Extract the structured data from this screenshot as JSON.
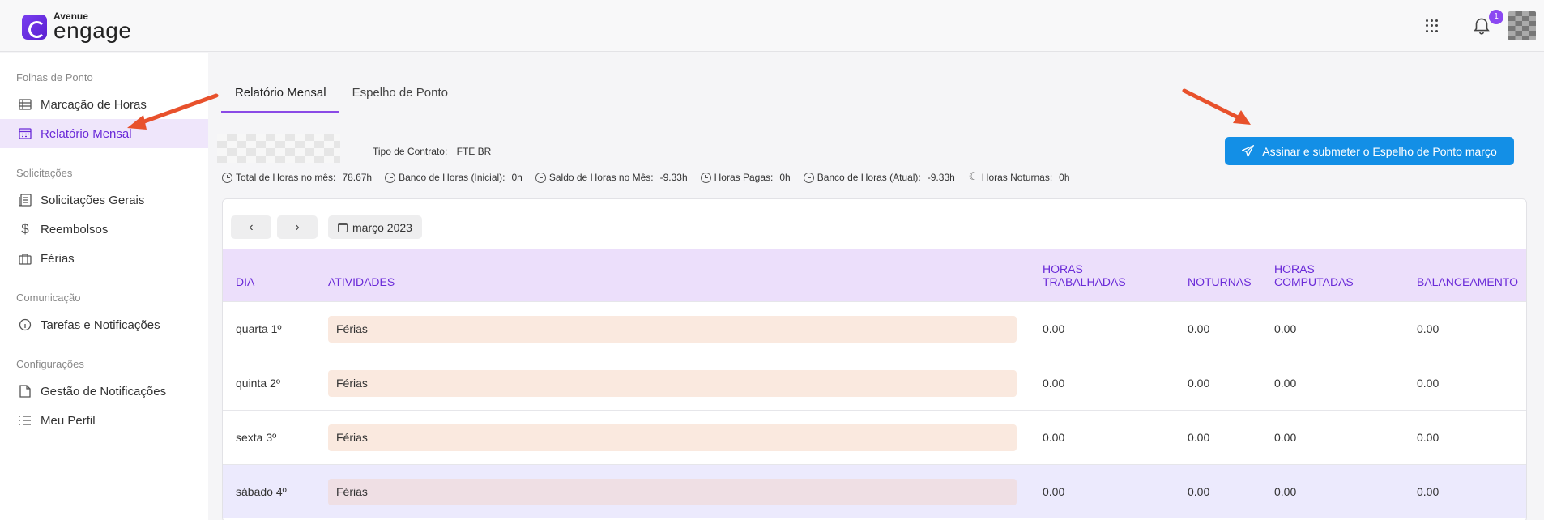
{
  "header": {
    "logo_small": "Avenue",
    "logo_big": "engage",
    "notification_count": "1"
  },
  "sidebar": {
    "sections": [
      {
        "label": "Folhas de Ponto"
      },
      {
        "label": "Solicitações"
      },
      {
        "label": "Comunicação"
      },
      {
        "label": "Configurações"
      }
    ],
    "items": [
      {
        "label": "Marcação de Horas",
        "icon": "list-icon"
      },
      {
        "label": "Relatório Mensal",
        "icon": "calendar-grid-icon",
        "active": true
      },
      {
        "label": "Solicitações Gerais",
        "icon": "newspaper-icon"
      },
      {
        "label": "Reembolsos",
        "icon": "dollar-icon"
      },
      {
        "label": "Férias",
        "icon": "suitcase-icon"
      },
      {
        "label": "Tarefas e Notificações",
        "icon": "info-icon"
      },
      {
        "label": "Gestão de Notificações",
        "icon": "document-icon"
      },
      {
        "label": "Meu Perfil",
        "icon": "bullet-list-icon"
      }
    ]
  },
  "tabs": [
    {
      "label": "Relatório Mensal",
      "active": true
    },
    {
      "label": "Espelho de Ponto"
    }
  ],
  "contract": {
    "label": "Tipo de Contrato:",
    "value": "FTE BR"
  },
  "submit_button": "Assinar e submeter o Espelho de Ponto março",
  "stats": [
    {
      "label": "Total de Horas no mês:",
      "value": "78.67h"
    },
    {
      "label": "Banco de Horas (Inicial):",
      "value": "0h"
    },
    {
      "label": "Saldo de Horas no Mês:",
      "value": "-9.33h"
    },
    {
      "label": "Horas Pagas:",
      "value": "0h"
    },
    {
      "label": "Banco de Horas (Atual):",
      "value": "-9.33h"
    },
    {
      "label": "Horas Noturnas:",
      "value": "0h"
    }
  ],
  "calendar": {
    "prev": "‹",
    "next": "›",
    "month": "março 2023"
  },
  "table": {
    "headers": {
      "dia": "DIA",
      "atividades": "ATIVIDADES",
      "horas_trabalhadas_1": "HORAS",
      "horas_trabalhadas_2": "TRABALHADAS",
      "noturnas": "NOTURNAS",
      "horas_computadas_1": "HORAS",
      "horas_computadas_2": "COMPUTADAS",
      "balanceamento": "BALANCEAMENTO"
    },
    "rows": [
      {
        "dia": "quarta 1º",
        "atividade": "Férias",
        "trabalhadas": "0.00",
        "noturnas": "0.00",
        "computadas": "0.00",
        "balanceamento": "0.00"
      },
      {
        "dia": "quinta 2º",
        "atividade": "Férias",
        "trabalhadas": "0.00",
        "noturnas": "0.00",
        "computadas": "0.00",
        "balanceamento": "0.00"
      },
      {
        "dia": "sexta 3º",
        "atividade": "Férias",
        "trabalhadas": "0.00",
        "noturnas": "0.00",
        "computadas": "0.00",
        "balanceamento": "0.00"
      },
      {
        "dia": "sábado 4º",
        "atividade": "Férias",
        "trabalhadas": "0.00",
        "noturnas": "0.00",
        "computadas": "0.00",
        "balanceamento": "0.00"
      }
    ]
  },
  "colors": {
    "accent": "#8a4ae6",
    "button": "#138fe6",
    "annotation_arrow": "#e8512c"
  }
}
